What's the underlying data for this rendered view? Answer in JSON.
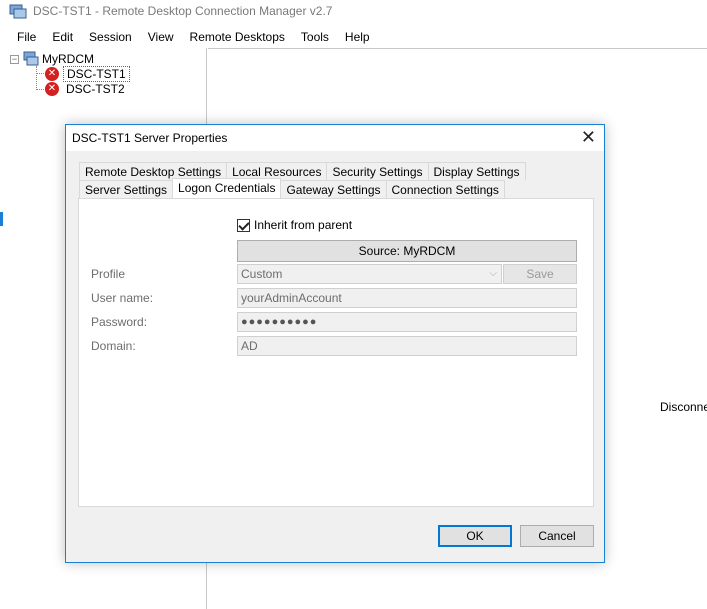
{
  "window": {
    "title": "DSC-TST1 - Remote Desktop Connection Manager v2.7"
  },
  "menu": {
    "items": [
      "File",
      "Edit",
      "Session",
      "View",
      "Remote Desktops",
      "Tools",
      "Help"
    ]
  },
  "tree": {
    "root_label": "MyRDCM",
    "expander_glyph": "−",
    "nodes": [
      {
        "label": "DSC-TST1",
        "selected": true
      },
      {
        "label": "DSC-TST2",
        "selected": false
      }
    ]
  },
  "right_pane": {
    "status_text": "Disconne"
  },
  "dialog": {
    "title": "DSC-TST1 Server Properties",
    "close_glyph": "✕",
    "tabs_row1": [
      "Remote Desktop Settings",
      "Local Resources",
      "Security Settings",
      "Display Settings"
    ],
    "tabs_row2": [
      "Server Settings",
      "Logon Credentials",
      "Gateway Settings",
      "Connection Settings"
    ],
    "active_tab": "Logon Credentials",
    "inherit_label": "Inherit from parent",
    "source_button": "Source: MyRDCM",
    "profile": {
      "label": "Profile",
      "value": "Custom",
      "save_label": "Save"
    },
    "username": {
      "label": "User name:",
      "value": "yourAdminAccount"
    },
    "password": {
      "label": "Password:",
      "value": "●●●●●●●●●●"
    },
    "domain": {
      "label": "Domain:",
      "value": "AD"
    },
    "ok_label": "OK",
    "cancel_label": "Cancel"
  },
  "colors": {
    "accent": "#0078d7",
    "error_icon": "#d32020"
  }
}
